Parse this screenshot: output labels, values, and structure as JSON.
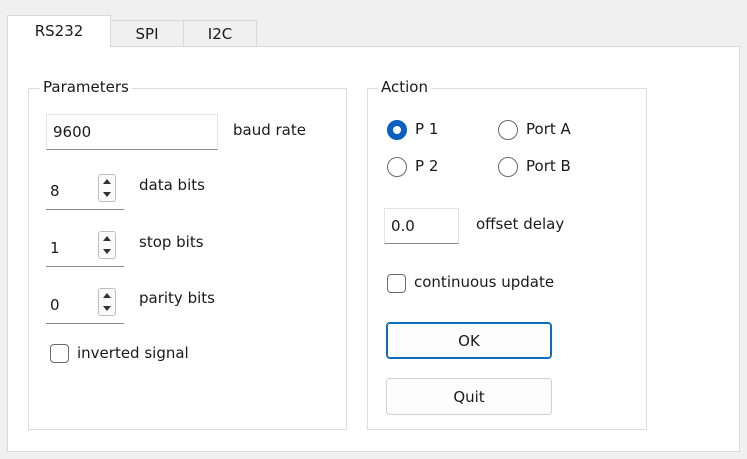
{
  "tabs": [
    {
      "label": "RS232",
      "active": true
    },
    {
      "label": "SPI",
      "active": false
    },
    {
      "label": "I2C",
      "active": false
    }
  ],
  "parameters": {
    "title": "Parameters",
    "baud_rate": {
      "value": "9600",
      "label": "baud rate"
    },
    "data_bits": {
      "value": "8",
      "label": "data bits"
    },
    "stop_bits": {
      "value": "1",
      "label": "stop bits"
    },
    "parity_bits": {
      "value": "0",
      "label": "parity bits"
    },
    "inverted_signal": {
      "label": "inverted signal",
      "checked": false
    }
  },
  "action": {
    "title": "Action",
    "radios": [
      {
        "label": "P 1",
        "checked": true
      },
      {
        "label": "Port A",
        "checked": false
      },
      {
        "label": "P 2",
        "checked": false
      },
      {
        "label": "Port B",
        "checked": false
      }
    ],
    "offset_delay": {
      "value": "0.0",
      "label": "offset delay"
    },
    "continuous_update": {
      "label": "continuous update",
      "checked": false
    },
    "ok_label": "OK",
    "quit_label": "Quit"
  },
  "colors": {
    "accent": "#0a5fbf",
    "background": "#f0f0f0",
    "panel": "#ffffff"
  }
}
